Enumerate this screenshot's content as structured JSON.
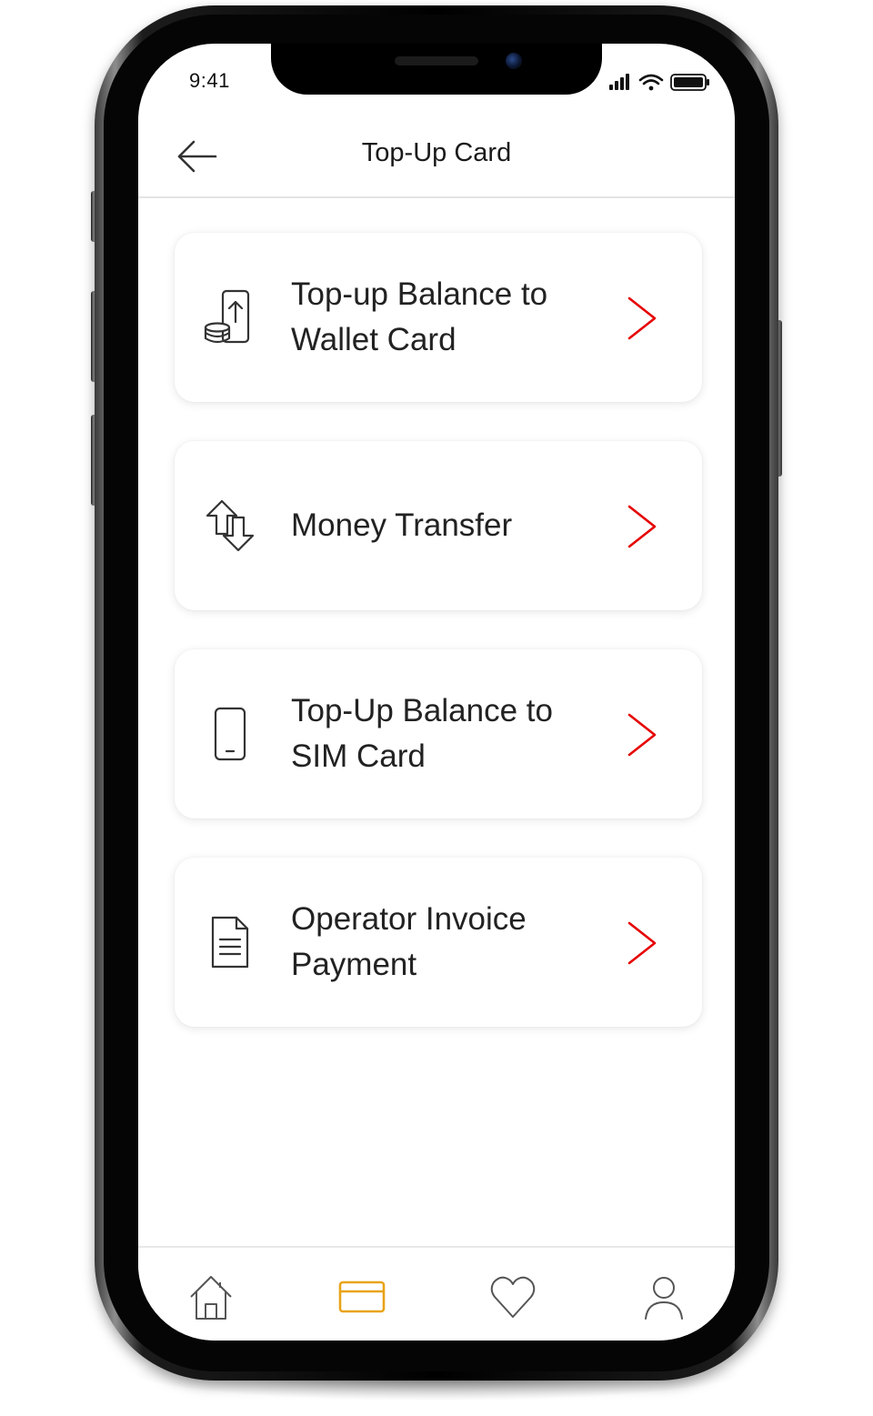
{
  "status_bar": {
    "time": "9:41"
  },
  "header": {
    "title": "Top-Up Card",
    "back_icon": "arrow-left-icon"
  },
  "menu": [
    {
      "label": "Top-up Balance to\nWallet Card",
      "icon": "phone-coins-upload-icon"
    },
    {
      "label": "Money Transfer",
      "icon": "transfer-arrows-icon"
    },
    {
      "label": "Top-Up Balance to\nSIM Card",
      "icon": "smartphone-icon"
    },
    {
      "label": "Operator Invoice\nPayment",
      "icon": "invoice-document-icon"
    }
  ],
  "tabbar": {
    "tabs": [
      {
        "icon": "home-icon",
        "active": false
      },
      {
        "icon": "card-icon",
        "active": true
      },
      {
        "icon": "heart-icon",
        "active": false
      },
      {
        "icon": "user-icon",
        "active": false
      }
    ]
  },
  "colors": {
    "accent_chevron": "#e60000",
    "tab_active": "#e8a317",
    "tab_inactive": "#555555"
  }
}
